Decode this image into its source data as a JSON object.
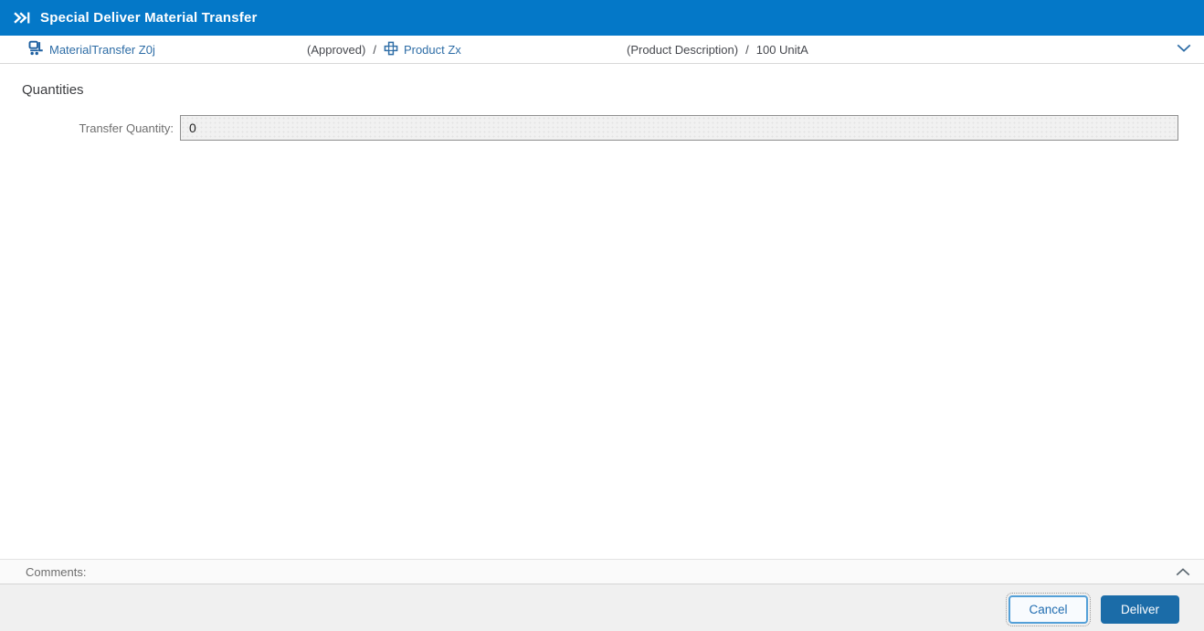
{
  "window": {
    "title": "Special Deliver Material Transfer"
  },
  "context_bar": {
    "entity": {
      "icon": "forklift-icon",
      "label": "MaterialTransfer Z0j"
    },
    "status": "(Approved)",
    "separator": "/",
    "product": {
      "icon": "product-icon",
      "label": "Product Zx"
    },
    "description": "(Product Description)",
    "quantity_summary": "100 UnitA",
    "collapse_icon": "chevron-down-icon"
  },
  "quantities": {
    "section_title": "Quantities",
    "transfer_quantity": {
      "label": "Transfer Quantity:",
      "value": "0"
    }
  },
  "comments": {
    "label": "Comments:",
    "collapse_icon": "chevron-up-icon"
  },
  "footer": {
    "cancel_label": "Cancel",
    "deliver_label": "Deliver"
  },
  "colors": {
    "header_blue": "#0478c8",
    "link_blue": "#2e6da6",
    "primary_button_blue": "#1b6ca8",
    "cancel_border_blue": "#54a0d8",
    "text_dark": "#46484e",
    "label_gray": "#6f6f6f",
    "disabled_field_bg": "#f1f1f1"
  }
}
